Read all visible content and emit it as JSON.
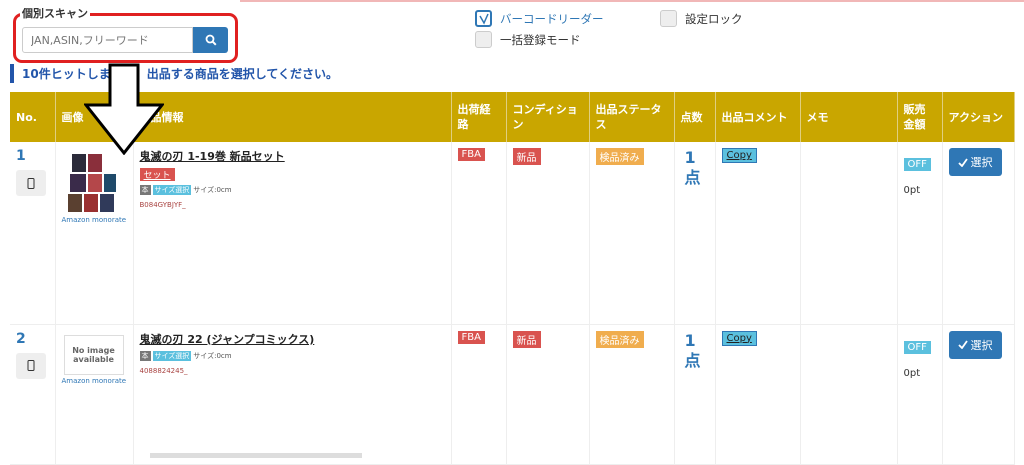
{
  "scan": {
    "label": "個別スキャン",
    "placeholder": "JAN,ASIN,フリーワード"
  },
  "options": {
    "barcode_reader": "バーコードリーダー",
    "bulk_register": "一括登録モード",
    "settings_lock": "設定ロック"
  },
  "hit_message": "10件ヒットしました。出品する商品を選択してください。",
  "table": {
    "headers": [
      "No.",
      "画像",
      "商品情報",
      "出荷経路",
      "コンディション",
      "出品ステータス",
      "点数",
      "出品コメント",
      "メモ",
      "販売金額",
      "アクション"
    ],
    "rows": [
      {
        "no": "1",
        "thumb_caption": "Amazon monorate",
        "title": "鬼滅の刃 1-19巻 新品セット",
        "tag": "セット",
        "badge_small": "本",
        "badge_size": "サイズ選択",
        "size_text": "サイズ:0cm",
        "asin": "B084GYBJYF_",
        "route": "FBA",
        "condition": "新品",
        "status": "検品済み",
        "qty_num": "1",
        "qty_unit": "点",
        "copy": "Copy",
        "price_toggle": "OFF",
        "points": "0pt",
        "select": "選択"
      },
      {
        "no": "2",
        "thumb_caption": "Amazon monorate",
        "no_image_1": "No image",
        "no_image_2": "available",
        "title": "鬼滅の刃 22 (ジャンプコミックス)",
        "badge_small": "本",
        "badge_size": "サイズ選択",
        "size_text": "サイズ:0cm",
        "asin": "4088824245_",
        "route": "FBA",
        "condition": "新品",
        "status": "検品済み",
        "qty_num": "1",
        "qty_unit": "点",
        "copy": "Copy",
        "price_toggle": "OFF",
        "points": "0pt",
        "select": "選択"
      }
    ]
  },
  "colors": {
    "header_bg": "#c9a600",
    "accent_blue": "#2f77b5",
    "highlight_red": "#e02020"
  }
}
